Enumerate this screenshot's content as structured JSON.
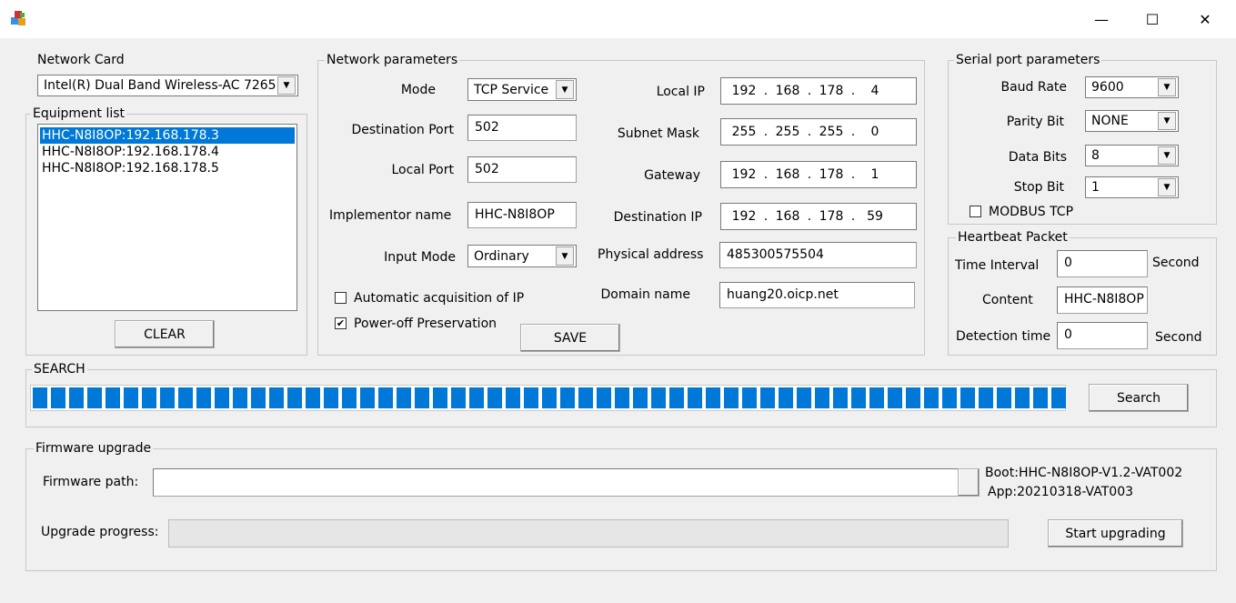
{
  "window": {
    "minimize_glyph": "—",
    "maximize_glyph": "☐",
    "close_glyph": "✕",
    "icon": "app-icon"
  },
  "network_card": {
    "label": "Network Card",
    "value": "Intel(R) Dual Band Wireless-AC 7265"
  },
  "equipment": {
    "legend": "Equipment list",
    "items": [
      "HHC-N8I8OP:192.168.178.3",
      "HHC-N8I8OP:192.168.178.4",
      "HHC-N8I8OP:192.168.178.5"
    ],
    "selected_index": 0,
    "clear_label": "CLEAR"
  },
  "network_params": {
    "legend": "Network parameters",
    "mode_label": "Mode",
    "mode_value": "TCP Service",
    "dest_port_label": "Destination Port",
    "dest_port_value": "502",
    "local_port_label": "Local Port",
    "local_port_value": "502",
    "implementor_label": "Implementor name",
    "implementor_value": "HHC-N8I8OP",
    "input_mode_label": "Input Mode",
    "input_mode_value": "Ordinary",
    "auto_ip_label": "Automatic acquisition of IP",
    "auto_ip_checked": false,
    "power_off_label": "Power-off Preservation",
    "power_off_checked": true,
    "local_ip_label": "Local IP",
    "local_ip": [
      "192",
      "168",
      "178",
      "4"
    ],
    "subnet_label": "Subnet Mask",
    "subnet": [
      "255",
      "255",
      "255",
      "0"
    ],
    "gateway_label": "Gateway",
    "gateway": [
      "192",
      "168",
      "178",
      "1"
    ],
    "dest_ip_label": "Destination IP",
    "dest_ip": [
      "192",
      "168",
      "178",
      "59"
    ],
    "ip_dot": ".",
    "mac_label": "Physical address",
    "mac_value": "485300575504",
    "domain_label": "Domain name",
    "domain_value": "huang20.oicp.net",
    "save_label": "SAVE",
    "check_glyph": "✔"
  },
  "serial": {
    "legend": "Serial port parameters",
    "baud_label": "Baud Rate",
    "baud_value": "9600",
    "parity_label": "Parity Bit",
    "parity_value": "NONE",
    "data_bits_label": "Data Bits",
    "data_bits_value": "8",
    "stop_bit_label": "Stop Bit",
    "stop_bit_value": "1",
    "modbus_label": "MODBUS TCP",
    "modbus_checked": false
  },
  "heartbeat": {
    "legend": "Heartbeat Packet",
    "interval_label": "Time Interval",
    "interval_value": "0",
    "interval_unit": "Second",
    "content_label": "Content",
    "content_value": "HHC-N8I8OP",
    "detection_label": "Detection time",
    "detection_value": "0",
    "detection_unit": "Second"
  },
  "search": {
    "legend": "SEARCH",
    "progress": 1.0,
    "button_label": "Search"
  },
  "firmware": {
    "legend": "Firmware upgrade",
    "path_label": "Firmware path:",
    "path_value": "",
    "boot_version": "Boot:HHC-N8I8OP-V1.2-VAT002",
    "app_version": "App:20210318-VAT003",
    "progress_label": "Upgrade progress:",
    "progress": 0,
    "start_label": "Start upgrading"
  },
  "colors": {
    "accent": "#0078d7",
    "background": "#f0f0f0"
  }
}
